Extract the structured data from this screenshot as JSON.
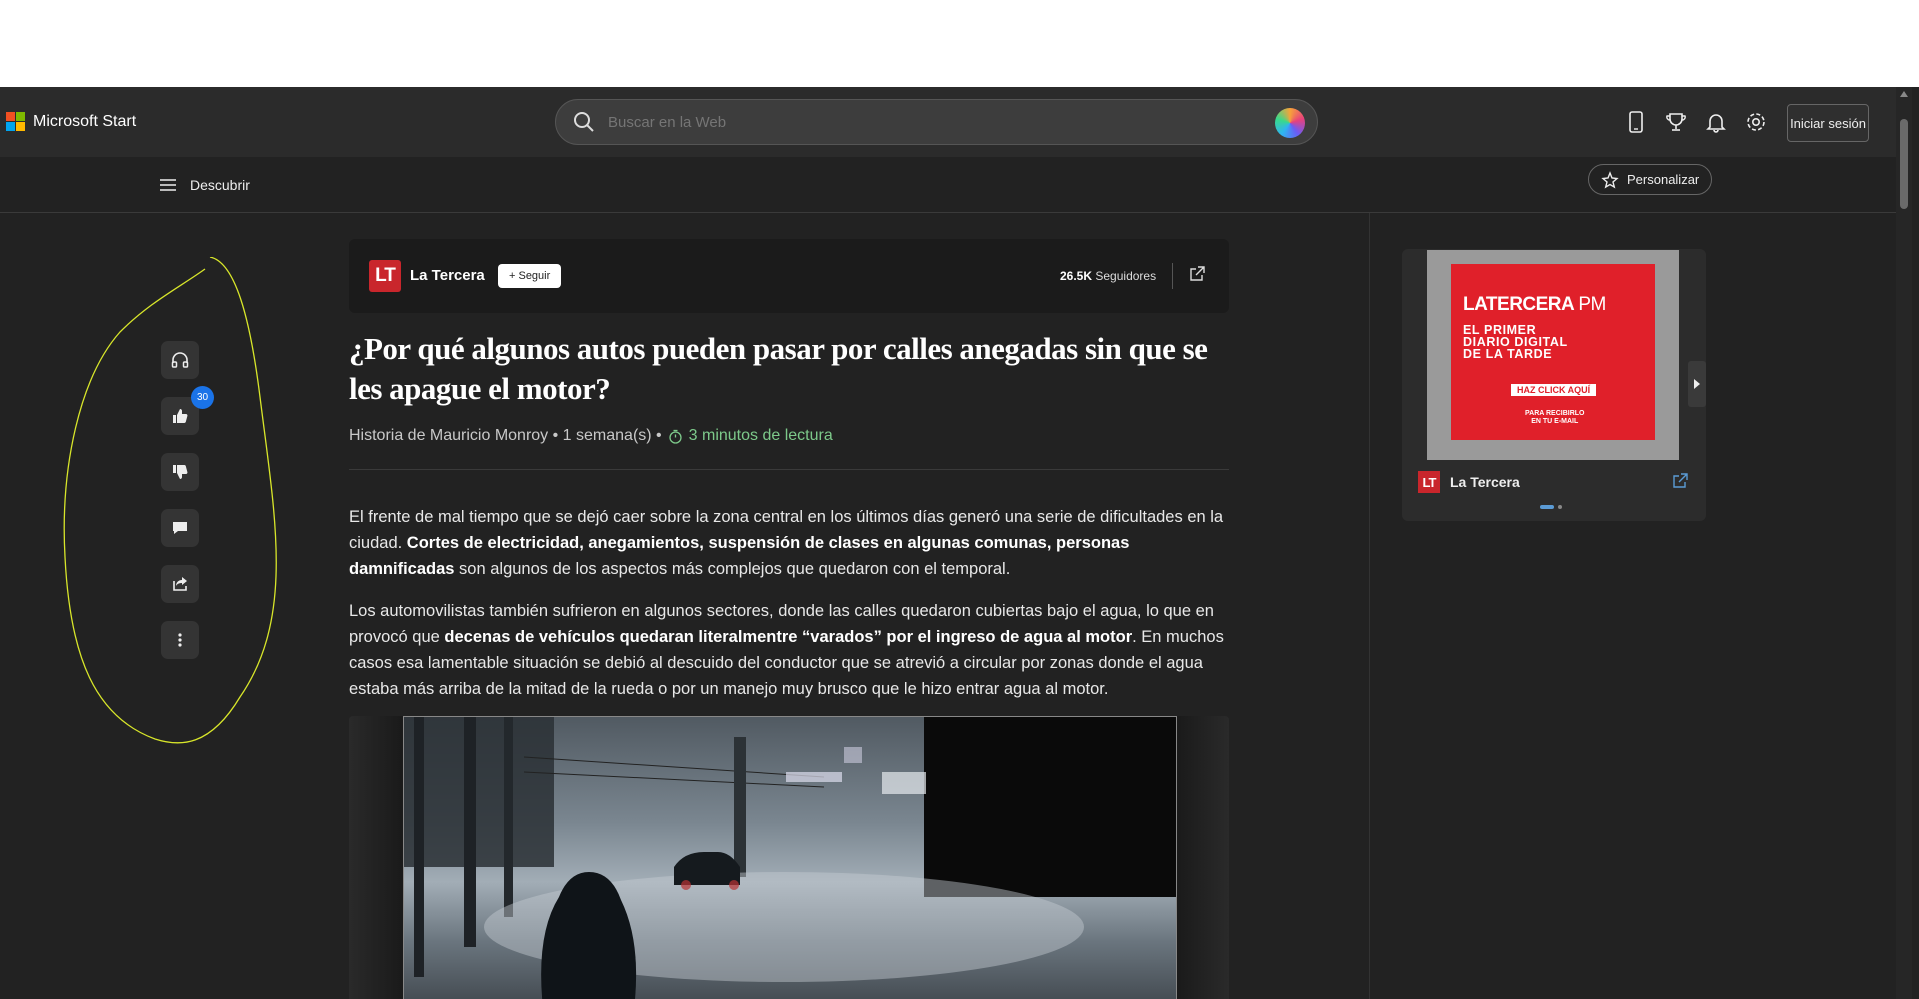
{
  "header": {
    "brand": "Microsoft Start",
    "brand_colors": [
      "#f25022",
      "#7fba00",
      "#00a4ef",
      "#ffb900"
    ],
    "search_placeholder": "Buscar en la Web",
    "tools": [
      "phone-icon",
      "trophy-icon",
      "bell-icon",
      "gear-icon"
    ],
    "signin_label": "Iniciar sesión"
  },
  "subnav": {
    "discover_label": "Descubrir",
    "personalize_label": "Personalizar"
  },
  "rail": {
    "buttons": [
      "headphones-icon",
      "thumbs-up-icon",
      "thumbs-down-icon",
      "comment-icon",
      "share-icon",
      "more-icon"
    ],
    "likes_count": "30"
  },
  "article": {
    "publisher": {
      "logo_text": "LT",
      "name": "La Tercera",
      "follow_label": "+ Seguir",
      "followers_count": "26.5K",
      "followers_label": "Seguidores"
    },
    "title": "¿Por qué algunos autos pueden pasar por calles anegadas sin que se les apague el motor?",
    "byline": "Historia de Mauricio Monroy • 1 semana(s) •",
    "read_time": "3 minutos de lectura",
    "paragraph1": {
      "part1": "El frente de mal tiempo que se dejó caer sobre la zona central en los últimos días generó una serie de dificultades en la ciudad. ",
      "bold": "Cortes de electricidad, anegamientos, suspensión de clases en algunas comunas, personas damnificadas",
      "part2": " son algunos de los aspectos más complejos que quedaron con el temporal."
    },
    "paragraph2": {
      "part1": "Los automovilistas también sufrieron en algunos sectores, donde las calles quedaron cubiertas bajo el agua, lo que en provocó que ",
      "bold": "decenas de vehículos quedaran literalmentre “varados” por el ingreso de agua al motor",
      "part2": ". En muchos casos esa lamentable situación se debió al descuido del conductor que se atrevió a circular por zonas donde el agua estaba más arriba de la mitad de la rueda o por un manejo muy brusco que le hizo entrar agua al motor."
    }
  },
  "ad": {
    "headline": "LATERCERA",
    "pm": "PM",
    "line1": "EL PRIMER",
    "line2": "DIARIO DIGITAL",
    "line3": "DE LA TARDE",
    "cta": "HAZ CLICK AQUÍ",
    "sub1": "PARA RECIBIRLO",
    "sub2": "EN TU E-MAIL",
    "source_logo": "LT",
    "source_name": "La Tercera"
  }
}
